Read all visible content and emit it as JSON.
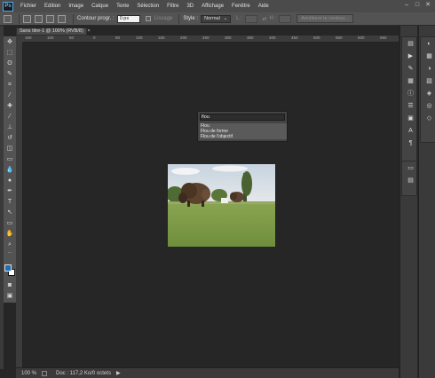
{
  "app": {
    "logo_text": "Ps"
  },
  "menu": {
    "items": [
      "Fichier",
      "Edition",
      "Image",
      "Calque",
      "Texte",
      "Sélection",
      "Filtre",
      "3D",
      "Affichage",
      "Fenêtre",
      "Aide"
    ]
  },
  "window_controls": {
    "minimize": "–",
    "maximize": "□",
    "close": "✕"
  },
  "options_bar": {
    "feather_label": "Contour progr. :",
    "feather_value": "0 px",
    "antialias_label": "Lissage",
    "style_label": "Style :",
    "style_value": "Normal",
    "width_label": "L :",
    "height_label": "H :",
    "refine_button": "Améliorer le contour..."
  },
  "document": {
    "tab_title": "Sans titre-1 @ 100% (RVB/8)",
    "tab_close": "×"
  },
  "ruler": {
    "top_labels": [
      "150",
      "100",
      "50",
      "0",
      "50",
      "100",
      "150",
      "200",
      "250",
      "300",
      "350",
      "400",
      "450",
      "500",
      "550",
      "600",
      "650"
    ]
  },
  "filter_search": {
    "query": "flou",
    "results": [
      "Flou",
      "Flou de forme",
      "Flou de l'objectif"
    ]
  },
  "status_bar": {
    "zoom": "100 %",
    "doc_info": "Doc : 117,2 Ko/0 octets",
    "arrow": "▶"
  },
  "tools": [
    "move-tool",
    "marquee-tool",
    "lasso-tool",
    "quick-select-tool",
    "crop-tool",
    "eyedropper-tool",
    "healing-tool",
    "brush-tool",
    "clone-stamp-tool",
    "history-brush-tool",
    "eraser-tool",
    "gradient-tool",
    "blur-tool",
    "dodge-tool",
    "pen-tool",
    "type-tool",
    "path-select-tool",
    "shape-tool",
    "hand-tool",
    "zoom-tool"
  ],
  "colors": {
    "foreground": "#1e6fb5",
    "background": "#ffffff",
    "accent": "#5aa7e0"
  }
}
